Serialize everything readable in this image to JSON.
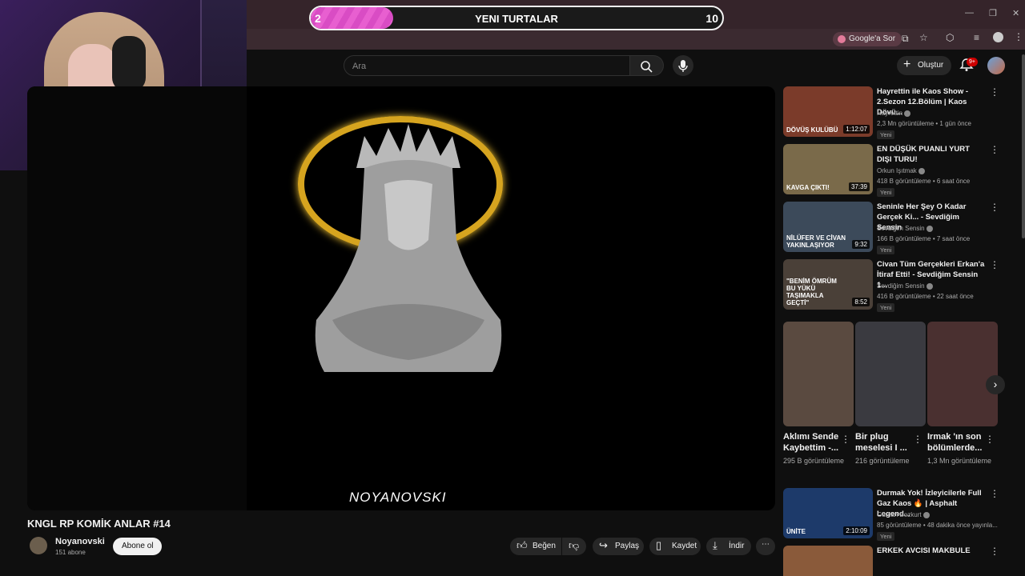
{
  "overlay": {
    "current": "2",
    "label": "YENI TURTALAR",
    "goal": "10",
    "progress_fraction": 0.2
  },
  "browser": {
    "ask_google": "Google'a Sor"
  },
  "header": {
    "search_placeholder": "Ara",
    "create_label": "Oluştur",
    "notif_count": "9+"
  },
  "player": {
    "watermark": "NOYANOVSKI"
  },
  "video": {
    "title": "KNGL RP KOMİK ANLAR #14",
    "channel": "Noyanovski",
    "subscribers": "151 abone",
    "subscribe_label": "Abone ol",
    "like_label": "Beğen",
    "share_label": "Paylaş",
    "save_label": "Kaydet",
    "download_label": "İndir"
  },
  "recommendations": [
    {
      "title": "Hayrettin ile Kaos Show - 2.Sezon 12.Bölüm | Kaos Dövü...",
      "channel": "Hayrettin",
      "meta": "2,3 Mn görüntüleme • 1 gün önce",
      "badge": "Yeni",
      "duration": "1:12:07",
      "thumb_text": "DÖVÜŞ KULÜBÜ",
      "color": "#7b3b2a"
    },
    {
      "title": "EN DÜŞÜK PUANLI YURT DIŞI TURU!",
      "channel": "Orkun Işıtmak",
      "meta": "418 B görüntüleme • 6 saat önce",
      "badge": "Yeni",
      "duration": "37:39",
      "thumb_text": "KAVGA ÇIKTI!",
      "color": "#7a6a4a"
    },
    {
      "title": "Seninle Her Şey O Kadar Gerçek Ki... - Sevdiğim Sensin",
      "channel": "Sevdiğim Sensin",
      "meta": "166 B görüntüleme • 7 saat önce",
      "badge": "Yeni",
      "duration": "9:32",
      "thumb_text": "NİLÜFER VE CİVAN YAKINLAŞIYOR",
      "color": "#3c4a5a"
    },
    {
      "title": "Civan Tüm Gerçekleri Erkan'a İtiraf Etti! - Sevdiğim Sensin 1...",
      "channel": "Sevdiğim Sensin",
      "meta": "416 B görüntüleme • 22 saat önce",
      "badge": "Yeni",
      "duration": "8:52",
      "thumb_text": "\"BENİM ÖMRÜM BU YÜKÜ TAŞIMAKLA GEÇTİ\"",
      "color": "#4a4038"
    }
  ],
  "shorts": [
    {
      "title": "Aklımı Sende Kaybettim -...",
      "views": "295 B görüntüleme",
      "color": "#5a4a40"
    },
    {
      "title": "Bir plug meselesi I ...",
      "views": "216 görüntüleme",
      "color": "#3a3a40"
    },
    {
      "title": "Irmak 'ın son bölümlerde...",
      "views": "1,3 Mn görüntüleme",
      "color": "#4a3030"
    }
  ],
  "recommendations2": [
    {
      "title": "Durmak Yok! İzleyicilerle Full Gaz Kaos 🔥 | Asphalt Legend...",
      "channel": "Gürcan Bozkurt",
      "meta": "85 görüntüleme • 48 dakika önce yayınla...",
      "badge": "Yeni",
      "duration": "2:10:09",
      "thumb_text": "ÜNİTE",
      "color": "#1d3a6a"
    },
    {
      "title": "ERKEK AVCISI MAKBULE",
      "color": "#8a5a3a"
    }
  ]
}
